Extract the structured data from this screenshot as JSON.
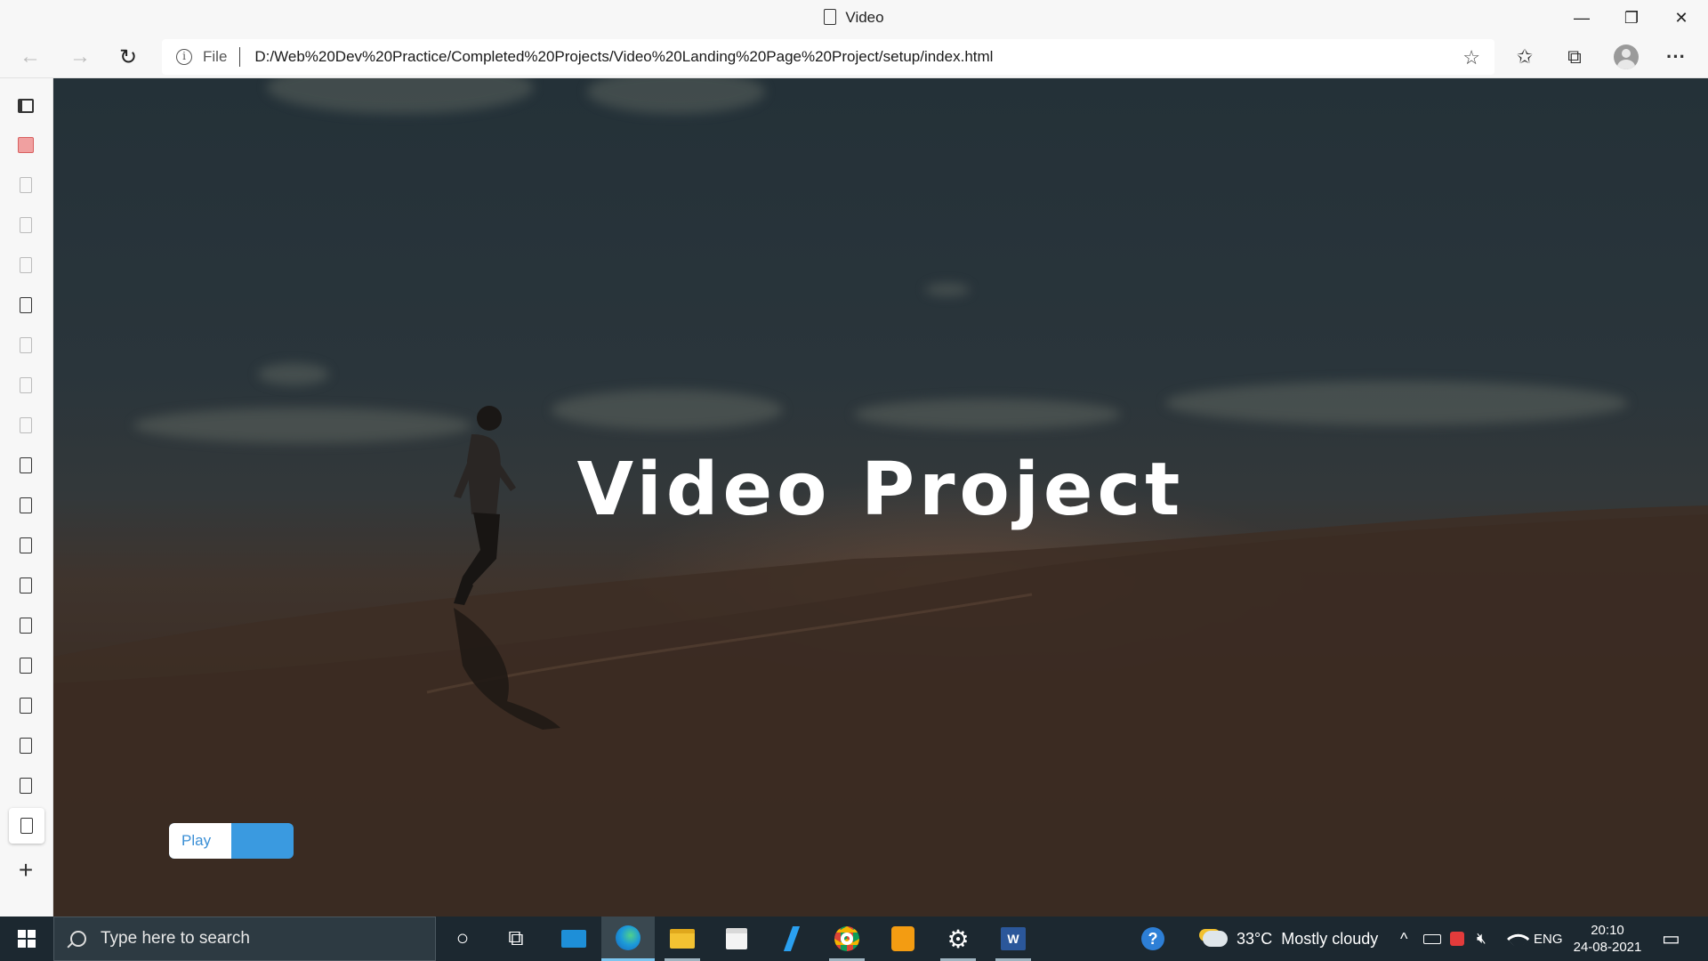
{
  "window": {
    "title": "Video",
    "minimize_glyph": "—",
    "restore_glyph": "❐",
    "close_glyph": "✕"
  },
  "toolbar": {
    "back_glyph": "←",
    "forward_glyph": "→",
    "refresh_glyph": "↻",
    "info_glyph": "i",
    "scheme": "File",
    "url": "D:/Web%20Dev%20Practice/Completed%20Projects/Video%20Landing%20Page%20Project/setup/index.html",
    "add_favorite_glyph": "☆",
    "favorites_glyph": "✩",
    "collections_glyph": "⧉",
    "menu_glyph": "···"
  },
  "sidebar": {
    "add_tab_glyph": "+"
  },
  "page": {
    "title": "Video Project",
    "play_label": "Play"
  },
  "taskbar": {
    "search_placeholder": "Type here to search",
    "cortana_glyph": "○",
    "taskview_glyph": "⧉",
    "help_glyph": "?",
    "weather_temp": "33°C",
    "weather_desc": "Mostly cloudy",
    "chevron_glyph": "^",
    "language": "ENG",
    "time": "20:10",
    "date": "24-08-2021",
    "notification_glyph": "▭"
  },
  "icons": [
    "document-icon",
    "sidebar-panel-icon",
    "calendar-icon",
    "windows-logo-icon",
    "search-icon",
    "mail-icon",
    "edge-icon",
    "file-explorer-icon",
    "store-icon",
    "vscode-icon",
    "chrome-icon",
    "sublime-icon",
    "settings-icon",
    "word-icon",
    "weather-icon",
    "battery-icon",
    "volume-muted-icon",
    "wifi-icon"
  ],
  "colors": {
    "accent": "#3a9ae0",
    "taskbar": "#1c2830",
    "chrome_bg": "#f7f7f7"
  }
}
